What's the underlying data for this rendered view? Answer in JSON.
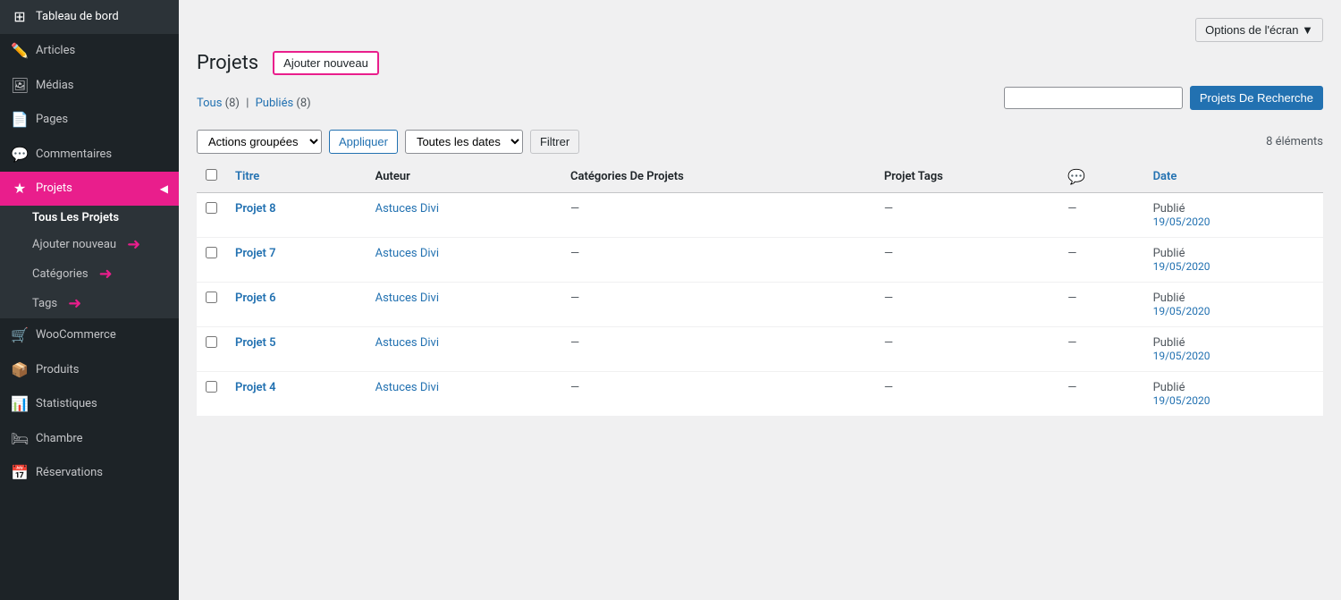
{
  "sidebar": {
    "items": [
      {
        "id": "tableau-de-bord",
        "label": "Tableau de bord",
        "icon": "⊞"
      },
      {
        "id": "articles",
        "label": "Articles",
        "icon": "✎"
      },
      {
        "id": "medias",
        "label": "Médias",
        "icon": "🖼"
      },
      {
        "id": "pages",
        "label": "Pages",
        "icon": "📄"
      },
      {
        "id": "commentaires",
        "label": "Commentaires",
        "icon": "💬"
      },
      {
        "id": "projets",
        "label": "Projets",
        "icon": "★",
        "active": true
      },
      {
        "id": "woocommerce",
        "label": "WooCommerce",
        "icon": "🛒"
      },
      {
        "id": "produits",
        "label": "Produits",
        "icon": "📦"
      },
      {
        "id": "statistiques",
        "label": "Statistiques",
        "icon": "📊"
      },
      {
        "id": "chambre",
        "label": "Chambre",
        "icon": "🛏"
      },
      {
        "id": "reservations",
        "label": "Réservations",
        "icon": "📅"
      }
    ],
    "submenu": {
      "header": "Tous Les Projets",
      "items": [
        {
          "id": "ajouter-nouveau",
          "label": "Ajouter nouveau"
        },
        {
          "id": "categories",
          "label": "Catégories"
        },
        {
          "id": "tags",
          "label": "Tags"
        }
      ]
    }
  },
  "header": {
    "screen_options_label": "Options de l'écran ▼",
    "page_title": "Projets",
    "add_new_label": "Ajouter nouveau"
  },
  "filter_links": {
    "tous_label": "Tous",
    "tous_count": "(8)",
    "separator": "|",
    "publies_label": "Publiés",
    "publies_count": "(8)"
  },
  "search": {
    "placeholder": "",
    "button_label": "Projets De Recherche"
  },
  "toolbar": {
    "actions_label": "Actions groupées",
    "apply_label": "Appliquer",
    "dates_label": "Toutes les dates",
    "filter_label": "Filtrer",
    "item_count": "8 éléments"
  },
  "table": {
    "columns": [
      {
        "id": "titre",
        "label": "Titre",
        "sortable": true
      },
      {
        "id": "auteur",
        "label": "Auteur",
        "sortable": false
      },
      {
        "id": "categories",
        "label": "Catégories De Projets",
        "sortable": false
      },
      {
        "id": "tags",
        "label": "Projet Tags",
        "sortable": false
      },
      {
        "id": "comments",
        "label": "💬",
        "sortable": false
      },
      {
        "id": "date",
        "label": "Date",
        "sortable": true
      }
    ],
    "rows": [
      {
        "id": 8,
        "titre": "Projet 8",
        "auteur": "Astuces Divi",
        "categories": "—",
        "tags": "—",
        "comments": "—",
        "status": "Publié",
        "date": "19/05/2020"
      },
      {
        "id": 7,
        "titre": "Projet 7",
        "auteur": "Astuces Divi",
        "categories": "—",
        "tags": "—",
        "comments": "—",
        "status": "Publié",
        "date": "19/05/2020"
      },
      {
        "id": 6,
        "titre": "Projet 6",
        "auteur": "Astuces Divi",
        "categories": "—",
        "tags": "—",
        "comments": "—",
        "status": "Publié",
        "date": "19/05/2020"
      },
      {
        "id": 5,
        "titre": "Projet 5",
        "auteur": "Astuces Divi",
        "categories": "—",
        "tags": "—",
        "comments": "—",
        "status": "Publié",
        "date": "19/05/2020"
      },
      {
        "id": 4,
        "titre": "Projet 4",
        "auteur": "Astuces Divi",
        "categories": "—",
        "tags": "—",
        "comments": "—",
        "status": "Publié",
        "date": "19/05/2020"
      }
    ]
  }
}
